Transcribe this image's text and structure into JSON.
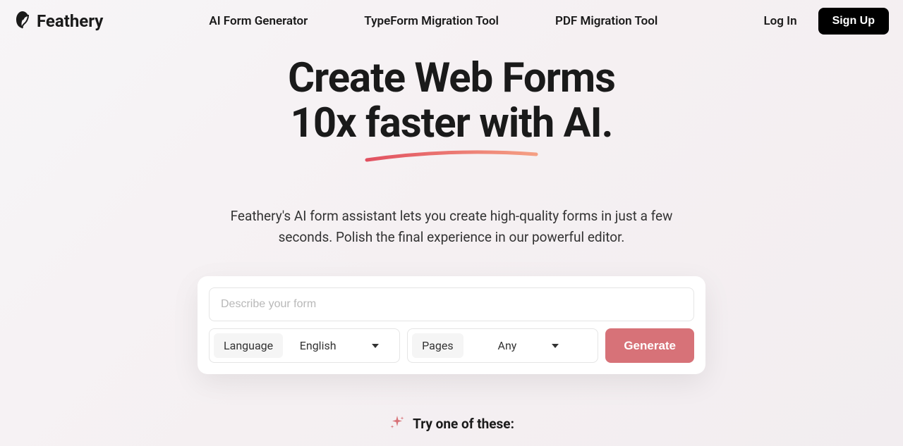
{
  "brand": {
    "name": "Feathery"
  },
  "nav": {
    "links": [
      "AI Form Generator",
      "TypeForm Migration Tool",
      "PDF Migration Tool"
    ]
  },
  "auth": {
    "login": "Log In",
    "signup": "Sign Up"
  },
  "hero": {
    "title_line1": "Create Web Forms",
    "title_line2": "10x faster with AI.",
    "subtitle": "Feathery's AI form assistant lets you create high-quality forms in just a few seconds. Polish the final experience in our powerful editor."
  },
  "form": {
    "describe_placeholder": "Describe your form",
    "language_label": "Language",
    "language_value": "English",
    "pages_label": "Pages",
    "pages_value": "Any",
    "generate_label": "Generate"
  },
  "try": {
    "heading": "Try one of these:"
  }
}
